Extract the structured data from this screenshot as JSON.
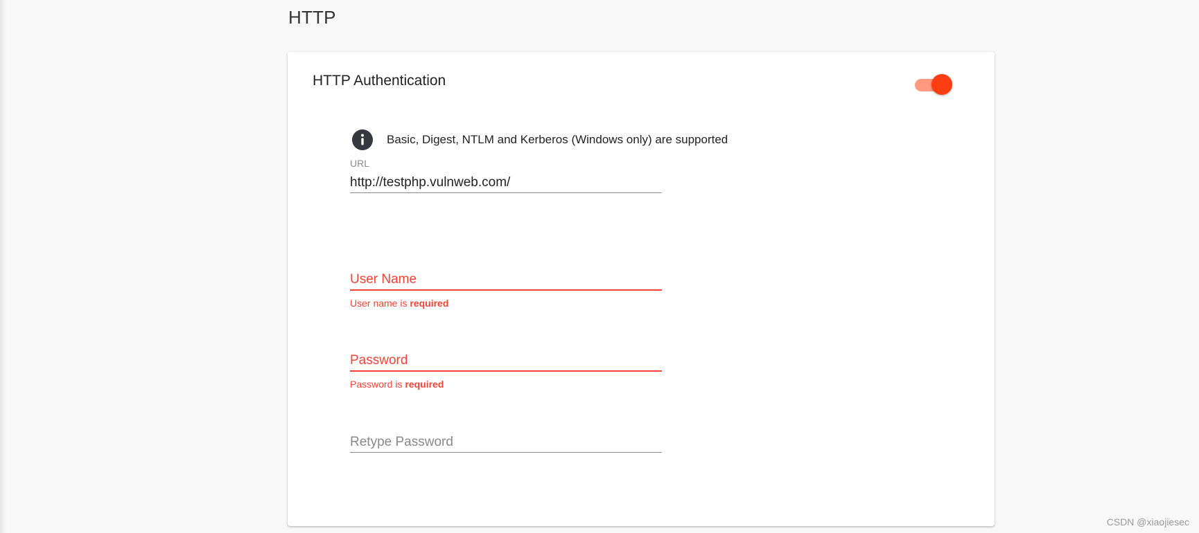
{
  "section": {
    "title": "HTTP"
  },
  "auth": {
    "title": "HTTP Authentication",
    "enabled": true,
    "toggle_color_track": "#ff9a80",
    "toggle_color_thumb": "#ff3d12",
    "info_icon": "info-icon",
    "info_text": "Basic, Digest, NTLM and Kerberos (Windows only) are supported"
  },
  "fields": {
    "url": {
      "label": "URL",
      "value": "http://testphp.vulnweb.com/"
    },
    "username": {
      "placeholder": "User Name",
      "error_prefix": "User name is",
      "error_strong": "required"
    },
    "password": {
      "placeholder": "Password",
      "error_prefix": "Password is",
      "error_strong": "required"
    },
    "retype_password": {
      "placeholder": "Retype Password"
    }
  },
  "colors": {
    "error": "#f44336",
    "accent": "#ff3d12"
  },
  "watermark": "CSDN @xiaojiesec"
}
